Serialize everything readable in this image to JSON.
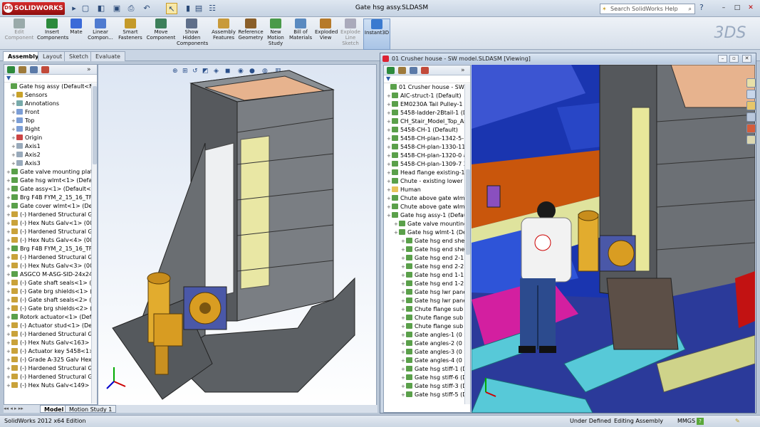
{
  "app": {
    "logo": "SOLIDWORKS",
    "window_title": "Gate hsg assy.SLDASM",
    "help_placeholder": "Search SolidWorks Help"
  },
  "ribbon": {
    "buttons": [
      {
        "label": "Edit\nComponent",
        "enabled": false
      },
      {
        "label": "Insert\nComponents",
        "enabled": true
      },
      {
        "label": "Mate",
        "enabled": true
      },
      {
        "label": "Linear\nCompon...",
        "enabled": true
      },
      {
        "label": "Smart\nFasteners",
        "enabled": true
      },
      {
        "label": "Move\nComponent",
        "enabled": true
      },
      {
        "label": "Show\nHidden\nComponents",
        "enabled": true
      },
      {
        "label": "Assembly\nFeatures",
        "enabled": true
      },
      {
        "label": "Reference\nGeometry",
        "enabled": true
      },
      {
        "label": "New\nMotion\nStudy",
        "enabled": true
      },
      {
        "label": "Bill of\nMaterials",
        "enabled": true
      },
      {
        "label": "Exploded\nView",
        "enabled": true
      },
      {
        "label": "Explode\nLine\nSketch",
        "enabled": false
      },
      {
        "label": "Instant3D",
        "enabled": true
      }
    ]
  },
  "tabs": [
    "Assembly",
    "Layout",
    "Sketch",
    "Evaluate"
  ],
  "left_tree": {
    "items": [
      "Gate hsg assy  (Default<New",
      "Sensors",
      "Annotations",
      "Front",
      "Top",
      "Right",
      "Origin",
      "Axis1",
      "Axis2",
      "Axis3",
      "Gate valve mounting plat",
      "Gate hsg wlmt<1> (Defau",
      "Gate assy<1> (Default<Di",
      "Brg F4B FYM_2_15_16_TF-",
      "Gate cover wlmt<1> (Def",
      "(-) Hardened Structural G",
      "(-) Hex Nuts Galv<1> (001",
      "(-) Hardened Structural G",
      "(-) Hex Nuts Galv<4> (001",
      "Brg F4B FYM_2_15_16_TF-",
      "(-) Hardened Structural G",
      "(-) Hex Nuts Galv<3> (001",
      "ASGCO M-ASG-SID-24x24",
      "(-) Gate shaft seals<1> (Sc",
      "(-) Gate brg shields<1> (D",
      "(-) Gate shaft seals<2> (Sc",
      "(-) Gate brg shields<2> (D",
      "Rotork actuator<1> (Defa",
      "(-) Actuator stud<1> (Def",
      "(-) Hardened Structural G",
      "(-) Hex Nuts Galv<163> (0",
      "(-) Actuator key 5458<1>",
      "(-) Grade A-325 Galv Hex",
      "(-) Hardened Structural G",
      "(-) Hardened Structural G",
      "(-) Hex Nuts Galv<149> (("
    ]
  },
  "bottom_tabs": [
    "Model",
    "Motion Study 1"
  ],
  "window2": {
    "title": "01 Crusher house - SW model.SLDASM [Viewing]",
    "tree": [
      "01 Crusher house - SW mode",
      "AIC-struct-1 (Default)",
      "EM0230A Tail Pulley-1 (D",
      "5458-ladder-2Btail-1 (De",
      "CH_Stair_Model_Top_Ass",
      "5458-CH-1 (Default)",
      "5458-CH-plan-1342-5-1 (",
      "5458-CH-plan-1330-11 a",
      "5458-CH-plan-1320-0 ass",
      "5458-CH-plan-1309-7 3_",
      "Head flange existing-1 (D",
      "Chute - existing lower se",
      "Human",
      "Chute above gate wlmt-2",
      "Chute above gate wlmt-1",
      "Gate hsg assy-1 (Default)",
      "Gate valve mounting",
      "Gate hsg wlmt-1 (Def",
      "Gate hsg end shee",
      "Gate hsg end shee",
      "Gate hsg end 2-1",
      "Gate hsg end 2-2",
      "Gate hsg end 1-1",
      "Gate hsg end 1-2",
      "Gate hsg lwr pane",
      "Gate hsg lwr pane",
      "Chute flange sub",
      "Chute flange sub",
      "Chute flange sub",
      "Gate angles-1 (0 S",
      "Gate angles-2 (0 S",
      "Gate angles-3 (0 S",
      "Gate angles-4 (0 S",
      "Gate hsg stiff-1 (D",
      "Gate hsg stiff-6 (D",
      "Gate hsg stiff-3 (D",
      "Gate hsg stiff-5 (D"
    ]
  },
  "status": {
    "edition": "SolidWorks 2012 x64 Edition",
    "defined": "Under Defined",
    "mode": "Editing Assembly",
    "units": "MMGS"
  },
  "colors": {
    "accent": "#2b5fa8",
    "viewport2_bg": "#1a35b0",
    "part_gray": "#6f7378",
    "yellow_panel": "#e8e79a"
  }
}
